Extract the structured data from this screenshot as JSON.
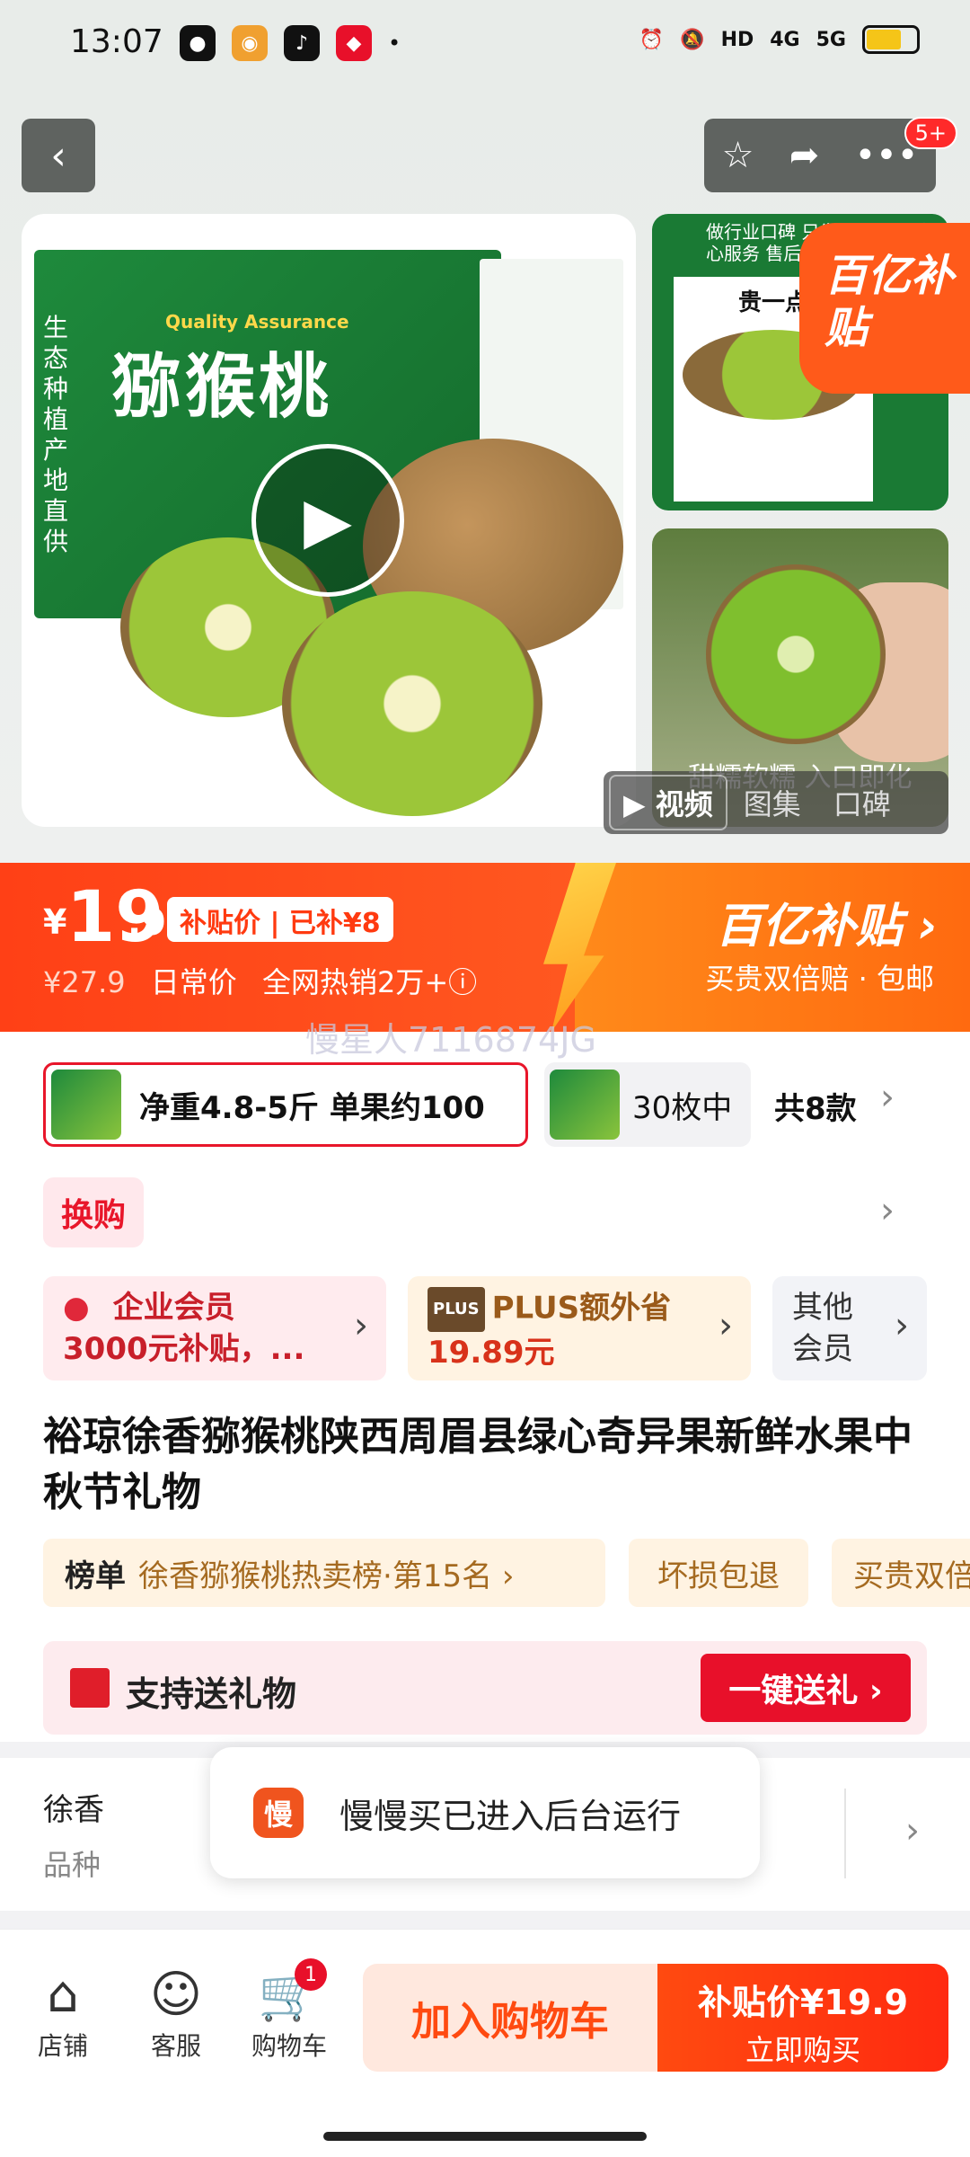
{
  "status": {
    "time": "13:07",
    "network": "4G",
    "network2": "5G",
    "hd": "HD"
  },
  "gallery": {
    "back": "‹",
    "top_badge": "5+",
    "box_quality": "Quality Assurance",
    "box_title": "猕猴桃",
    "box_side_text": "生态种植产地直供",
    "thumb1_header": "做行业口碑 只发精选果 做良心服务 售后无忧 不拼价格",
    "thumb1_paper_title": "贵一点",
    "subsidy_tag": "百亿补贴",
    "thumb2_caption": "甜糯软糯 入口即化",
    "media_tabs": [
      "视频",
      "图集",
      "口碑"
    ]
  },
  "price": {
    "yen": "¥",
    "main": "19",
    "decimal": ".9",
    "subsidy_label": "补贴价 | 已补¥8",
    "original": "¥27.9",
    "original_label": "日常价",
    "sales": "全网热销2万+ⓘ",
    "brand": "百亿补贴",
    "brand_sub": "买贵双倍赔 · 包邮"
  },
  "watermark": "慢星人7116874JG",
  "specs": {
    "active": "净重4.8-5斤 单果约100",
    "other": "30枚中",
    "count": "共8款"
  },
  "swap": "换购",
  "members": [
    {
      "line1": "企业会员",
      "line2": "3000元补贴，..."
    },
    {
      "plus": "PLUS",
      "line1": "PLUS额外省",
      "line2": "19.89元"
    },
    {
      "line1": "其他",
      "line2": "会员"
    }
  ],
  "title": "裕琼徐香猕猴桃陕西周眉县绿心奇异果新鲜水果中秋节礼物",
  "rank": {
    "key": "榜单",
    "value": "徐香猕猴桃热卖榜·第15名 ›"
  },
  "tags": [
    "坏损包退",
    "买贵双倍"
  ],
  "gift": {
    "label": "支持送礼物",
    "button": "一键送礼 ›"
  },
  "attrs": {
    "value": "徐香",
    "key": "品种"
  },
  "toast": {
    "icon": "慢",
    "text": "慢慢买已进入后台运行"
  },
  "bottom": {
    "shop": "店铺",
    "service": "客服",
    "cart": "购物车",
    "cart_count": "1",
    "add_cart": "加入购物车",
    "buy_line1": "补贴价¥19.9",
    "buy_line2": "立即购买"
  },
  "colors": {
    "accent": "#ff4a10",
    "red": "#e8102a",
    "gold": "#a56a20"
  }
}
